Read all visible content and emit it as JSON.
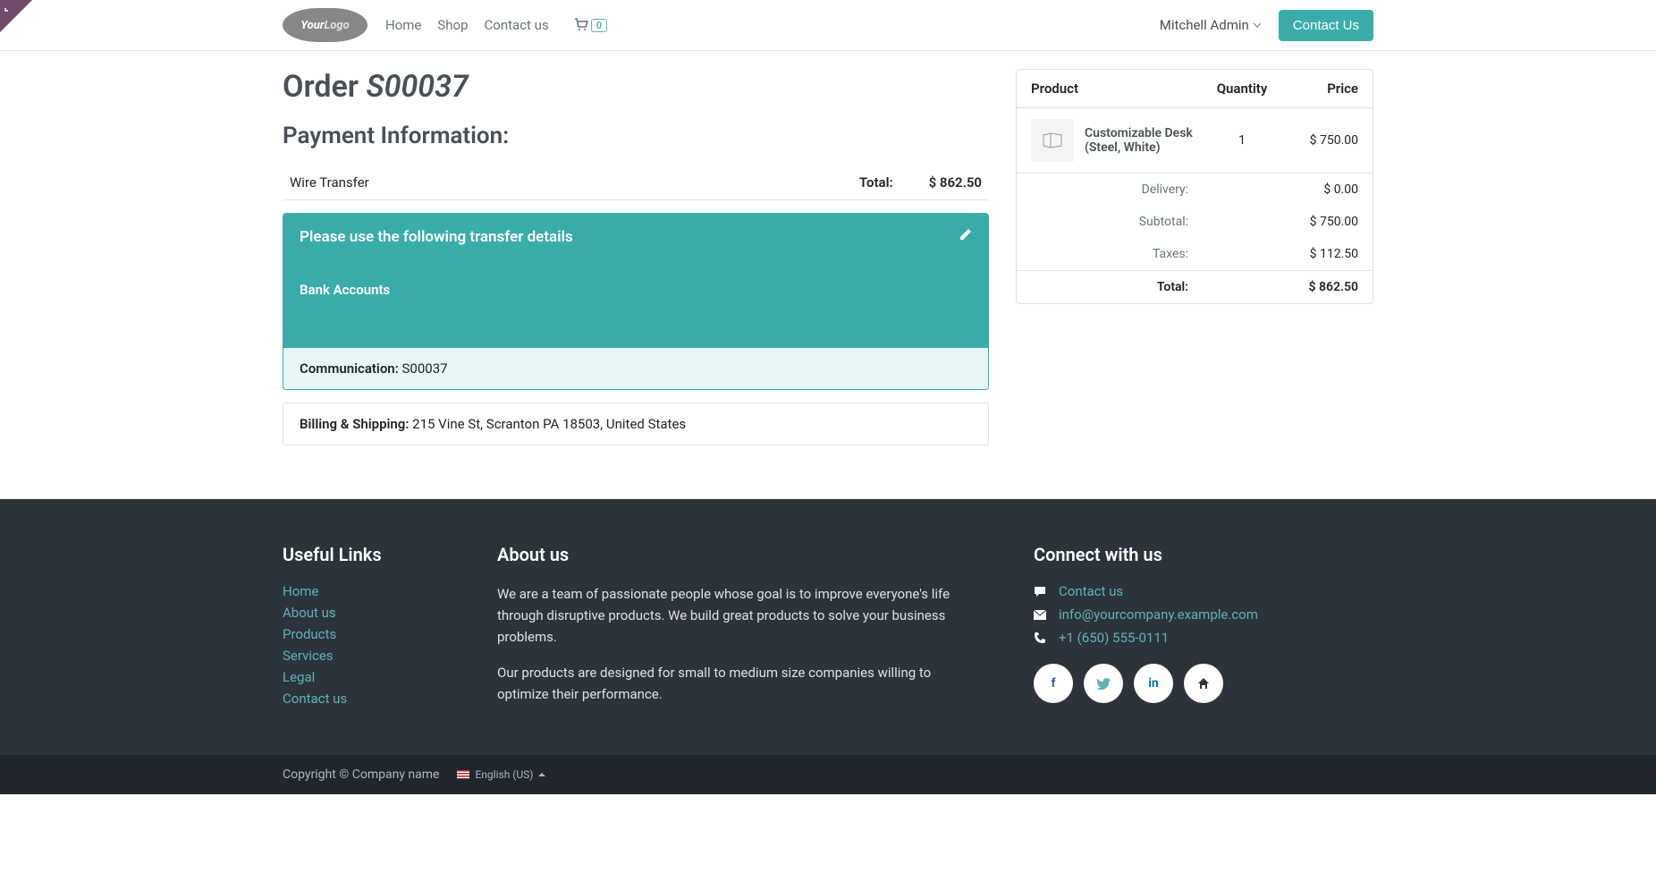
{
  "nav": {
    "home": "Home",
    "shop": "Shop",
    "contact": "Contact us",
    "cart_count": "0"
  },
  "header": {
    "user": "Mitchell Admin",
    "contact_btn": "Contact Us"
  },
  "order": {
    "title_prefix": "Order ",
    "number": "S00037",
    "payment_heading": "Payment Information:",
    "method": "Wire Transfer",
    "total_label": "Total:",
    "total_value": "$ 862.50",
    "transfer_title": "Please use the following transfer details",
    "bank_accounts": "Bank Accounts",
    "communication_label": "Communication: ",
    "communication_value": "S00037",
    "shipping_label": "Billing & Shipping: ",
    "shipping_value": "215 Vine St, Scranton PA 18503, United States"
  },
  "summary": {
    "col_product": "Product",
    "col_qty": "Quantity",
    "col_price": "Price",
    "item_name": "Customizable Desk (Steel, White)",
    "item_qty": "1",
    "item_price": "$ 750.00",
    "delivery_label": "Delivery:",
    "delivery_value": "$ 0.00",
    "subtotal_label": "Subtotal:",
    "subtotal_value": "$ 750.00",
    "taxes_label": "Taxes:",
    "taxes_value": "$ 112.50",
    "total_label": "Total:",
    "total_value": "$ 862.50"
  },
  "footer": {
    "useful_links": "Useful Links",
    "links": {
      "home": "Home",
      "about": "About us",
      "products": "Products",
      "services": "Services",
      "legal": "Legal",
      "contact": "Contact us"
    },
    "about_heading": "About us",
    "about_p1": "We are a team of passionate people whose goal is to improve everyone's life through disruptive products. We build great products to solve your business problems.",
    "about_p2": "Our products are designed for small to medium size companies willing to optimize their performance.",
    "connect_heading": "Connect with us",
    "contact_link": "Contact us",
    "email": "info@yourcompany.example.com",
    "phone": "+1 (650) 555-0111",
    "copyright": "Copyright © Company name",
    "language": "English (US)"
  }
}
